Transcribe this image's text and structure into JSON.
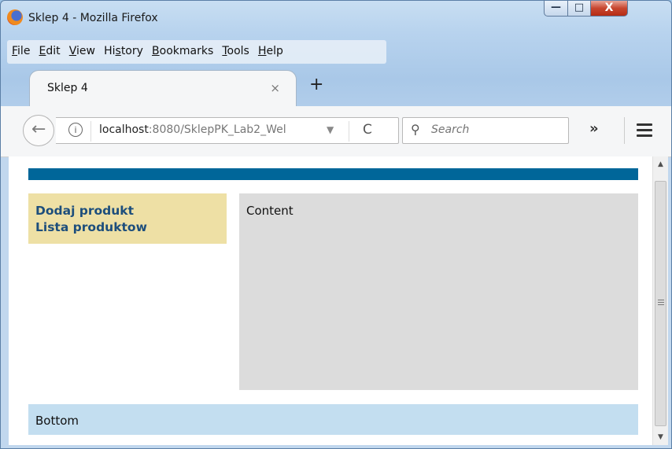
{
  "window": {
    "title": "Sklep 4 - Mozilla Firefox",
    "min_glyph": "—",
    "max_glyph": "□",
    "close_glyph": "X"
  },
  "menubar": {
    "items": [
      "File",
      "Edit",
      "View",
      "History",
      "Bookmarks",
      "Tools",
      "Help"
    ],
    "access_keys": [
      "F",
      "E",
      "V",
      "s",
      "B",
      "T",
      "H"
    ]
  },
  "tabs": [
    {
      "label": "Sklep 4",
      "close": "×"
    }
  ],
  "new_tab": "+",
  "navbar": {
    "back": "🡐",
    "info": "i",
    "url_host": "localhost",
    "url_path": ":8080/SklepPK_Lab2_Wel",
    "dropdown": "▼",
    "reload": "C",
    "search_placeholder": "Search",
    "overflow": "»"
  },
  "page": {
    "menu_links": [
      "Dodaj produkt",
      "Lista produktow"
    ],
    "content": "Content",
    "bottom": "Bottom"
  },
  "colors": {
    "header_bar": "#006699",
    "menu_bg": "#eee0a5",
    "content_bg": "#dcdcdc",
    "bottom_bg": "#c3def0",
    "link": "#1d4e7c"
  },
  "icons": {
    "browser": "firefox-logo-icon",
    "search": "search-icon",
    "menu": "hamburger-icon"
  }
}
